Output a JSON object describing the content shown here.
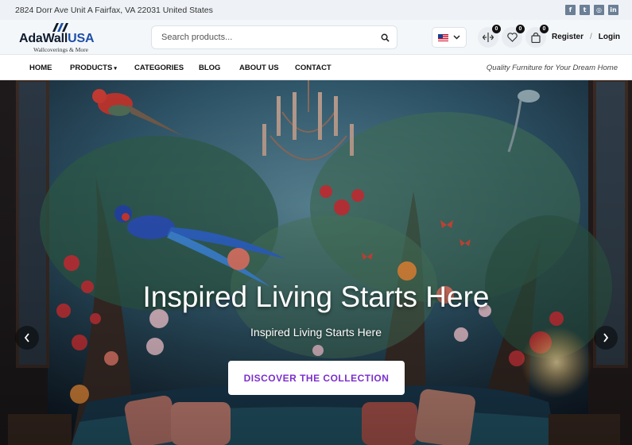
{
  "topbar": {
    "address": "2824 Dorr Ave Unit A Fairfax, VA 22031 United States",
    "social": [
      {
        "icon": "facebook-icon",
        "glyph": "f"
      },
      {
        "icon": "twitter-icon",
        "glyph": "t"
      },
      {
        "icon": "instagram-icon",
        "glyph": "◎"
      },
      {
        "icon": "linkedin-icon",
        "glyph": "in"
      }
    ]
  },
  "header": {
    "logo": {
      "brand_dark": "AdaWall",
      "brand_blue": "USA",
      "tagline": "Wallcoverings & More"
    },
    "search": {
      "placeholder": "Search products..."
    },
    "language": {
      "icon": "us-flag-icon"
    },
    "compare_count": "0",
    "wishlist_count": "0",
    "cart_count": "0",
    "register_label": "Register",
    "separator": "/",
    "login_label": "Login"
  },
  "nav": {
    "home": "HOME",
    "products": "PRODUCTS",
    "categories": "CATEGORIES",
    "blog": "BLOG",
    "about": "ABOUT US",
    "contact": "CONTACT",
    "slogan": "Quality Furniture for Your Dream Home"
  },
  "hero": {
    "title": "Inspired Living Starts Here",
    "subtitle": "Inspired Living Starts Here",
    "cta_label": "DISCOVER THE COLLECTION"
  },
  "colors": {
    "accent": "#7b2fcc",
    "brand_blue": "#1e4fa6",
    "topbar_bg": "#eef2f6"
  }
}
